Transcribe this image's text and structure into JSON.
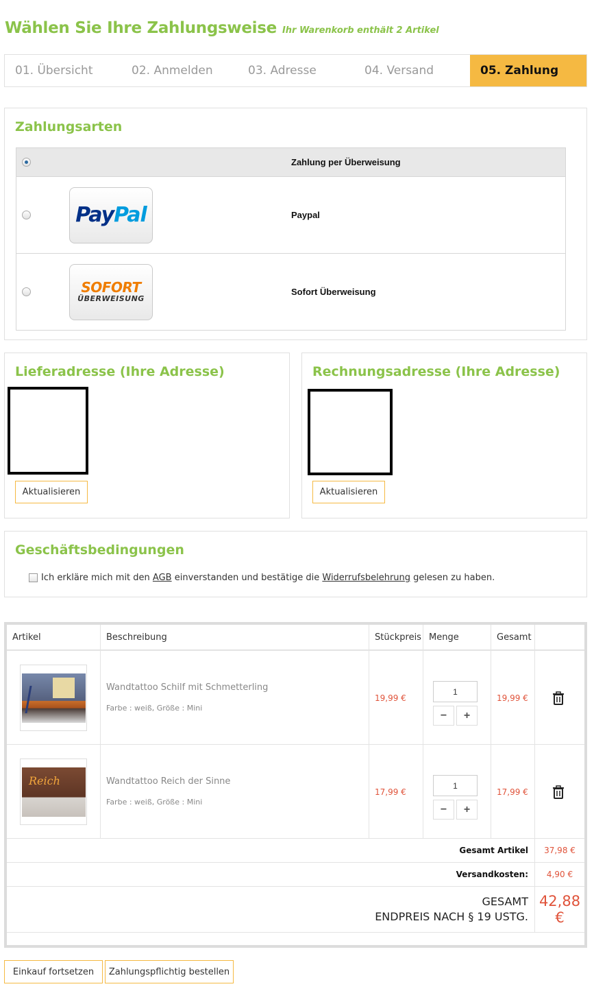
{
  "header": {
    "title": "Wählen Sie Ihre Zahlungsweise",
    "cart_info": "Ihr Warenkorb enthält 2 Artikel"
  },
  "steps": [
    {
      "label": "01. Übersicht"
    },
    {
      "label": "02. Anmelden"
    },
    {
      "label": "03. Adresse"
    },
    {
      "label": "04. Versand"
    },
    {
      "label": "05. Zahlung"
    }
  ],
  "payment": {
    "title": "Zahlungsarten",
    "options": [
      {
        "label": "Zahlung per Überweisung",
        "selected": true
      },
      {
        "label": "Paypal",
        "logo_text_1": "Pay",
        "logo_text_2": "Pal",
        "selected": false
      },
      {
        "label": "Sofort Überweisung",
        "logo_text_1": "SOFORT",
        "logo_text_2": "ÜBERWEISUNG",
        "selected": false
      }
    ]
  },
  "shipping_address": {
    "title": "Lieferadresse (Ihre Adresse)",
    "button": "Aktualisieren"
  },
  "billing_address": {
    "title": "Rechnungsadresse (Ihre Adresse)",
    "button": "Aktualisieren"
  },
  "terms": {
    "title": "Geschäftsbedingungen",
    "text_before": "Ich erkläre mich mit den",
    "agb_link": "AGB",
    "text_middle": "einverstanden und bestätige die",
    "withdrawal_link": "Widerrufsbelehrung",
    "text_after": "gelesen zu haben."
  },
  "cart": {
    "columns": [
      "Artikel",
      "Beschreibung",
      "Stückpreis",
      "Menge",
      "Gesamt",
      ""
    ],
    "items": [
      {
        "name": "Wandtattoo Schilf mit Schmetterling",
        "attributes": "Farbe : weiß, Größe : Mini",
        "unit_price": "19,99 €",
        "quantity": "1",
        "total": "19,99 €"
      },
      {
        "name": "Wandtattoo Reich der Sinne",
        "attributes": "Farbe : weiß, Größe : Mini",
        "unit_price": "17,99 €",
        "quantity": "1",
        "total": "17,99 €"
      }
    ],
    "subtotal_label": "Gesamt Artikel",
    "subtotal_value": "37,98 €",
    "shipping_label": "Versandkosten:",
    "shipping_value": "4,90 €",
    "total_label_1": "GESAMT",
    "total_label_2": "ENDPREIS NACH § 19 USTG.",
    "total_value_1": "42,88",
    "total_value_2": "€"
  },
  "footer": {
    "continue_button": "Einkauf fortsetzen",
    "order_button": "Zahlungspflichtig bestellen"
  },
  "colors": {
    "accent_green": "#8bc34a",
    "accent_orange": "#f5b942",
    "price_red": "#e0533a"
  }
}
